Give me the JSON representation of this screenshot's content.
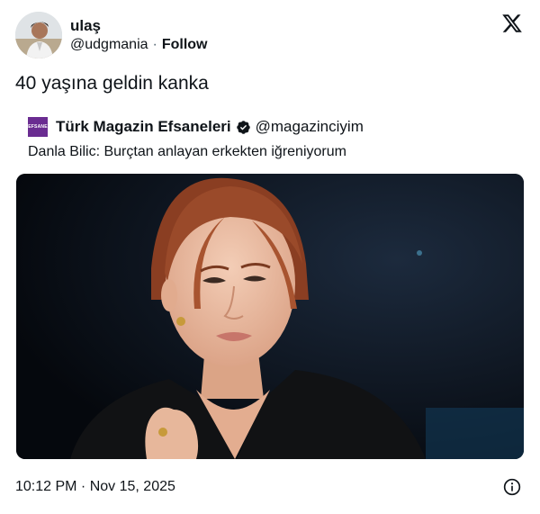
{
  "author": {
    "name": "ulaş",
    "handle": "@udgmania",
    "separator": "·",
    "follow_label": "Follow"
  },
  "tweet": {
    "text": "40 yaşına geldin kanka",
    "timestamp": "10:12 PM · Nov 15, 2025"
  },
  "quoted": {
    "avatar_text": "EFSANE",
    "name": "Türk Magazin Efsaneleri",
    "handle": "@magazinciyim",
    "text": "Danla Bilic: Burçtan anlayan erkekten iğreniyorum"
  },
  "colors": {
    "text": "#0f1419",
    "muted": "#536471",
    "quoted_avatar_bg": "#6a2c91"
  },
  "icons": {
    "brand": "x-logo-icon",
    "verified": "verified-badge-icon",
    "info": "info-icon"
  }
}
